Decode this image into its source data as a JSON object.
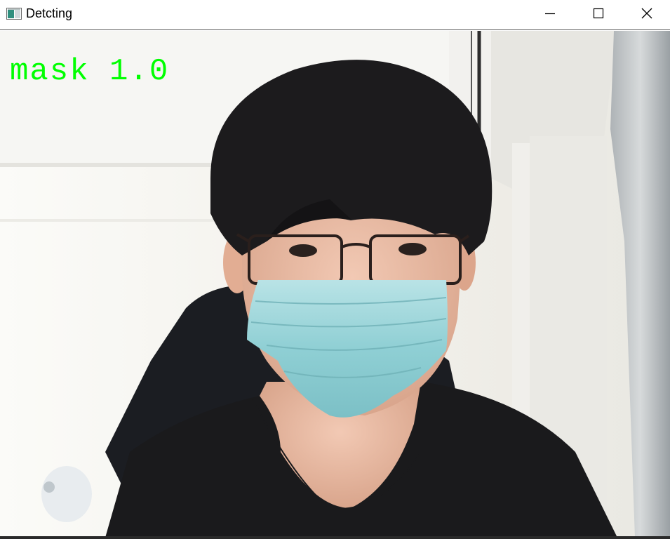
{
  "window": {
    "title": "Detcting",
    "icon": "image-window-icon",
    "controls": {
      "minimize_icon": "minimize-icon",
      "maximize_icon": "maximize-icon",
      "close_icon": "close-icon"
    }
  },
  "video": {
    "label": "mask",
    "confidence": "1.0",
    "label_color": "#00ff00"
  }
}
